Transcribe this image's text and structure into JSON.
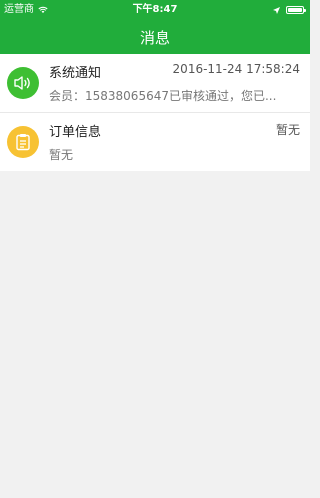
{
  "status_bar": {
    "carrier": "运营商",
    "time": "下午8:47"
  },
  "nav": {
    "title": "消息"
  },
  "colors": {
    "header_bg": "#21ad3b",
    "notify_icon_bg": "#3ebf33",
    "order_icon_bg": "#f7c233"
  },
  "messages": [
    {
      "title": "系统通知",
      "time": "2016-11-24 17:58:24",
      "preview": "会员：15838065647已审核通过，您已...",
      "icon": "speaker-icon"
    },
    {
      "title": "订单信息",
      "time": "暂无",
      "preview": "暂无",
      "icon": "clipboard-icon"
    }
  ]
}
